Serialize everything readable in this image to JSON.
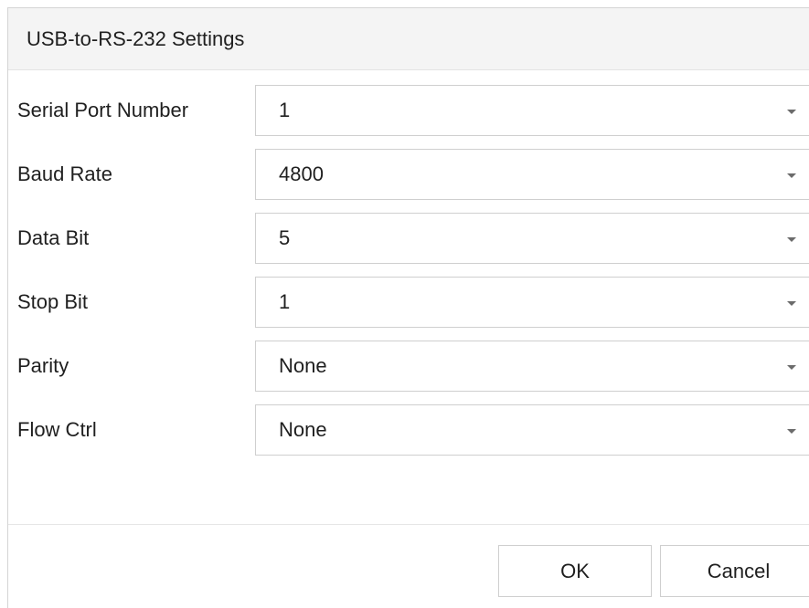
{
  "dialog": {
    "title": "USB-to-RS-232 Settings",
    "fields": [
      {
        "label": "Serial Port Number",
        "value": "1"
      },
      {
        "label": "Baud Rate",
        "value": "4800"
      },
      {
        "label": "Data Bit",
        "value": "5"
      },
      {
        "label": "Stop Bit",
        "value": "1"
      },
      {
        "label": "Parity",
        "value": "None"
      },
      {
        "label": "Flow Ctrl",
        "value": "None"
      }
    ],
    "buttons": {
      "ok": "OK",
      "cancel": "Cancel"
    }
  },
  "icons": {
    "dropdown": "chevron-down-icon"
  }
}
